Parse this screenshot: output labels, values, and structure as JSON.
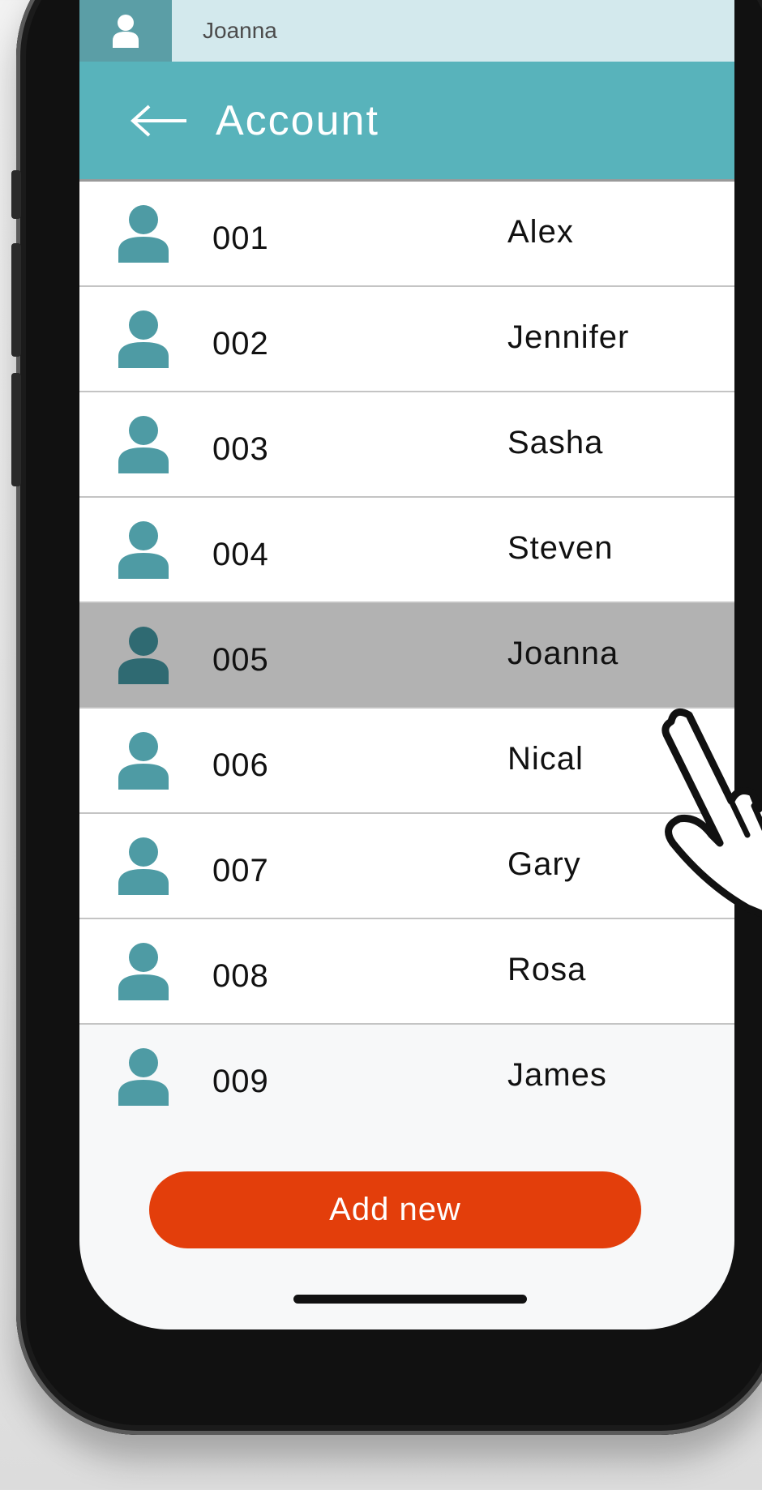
{
  "status_bar": {
    "user_name": "Joanna"
  },
  "header": {
    "title": "Account"
  },
  "accounts": [
    {
      "id": "001",
      "name": "Alex",
      "selected": false
    },
    {
      "id": "002",
      "name": "Jennifer",
      "selected": false
    },
    {
      "id": "003",
      "name": "Sasha",
      "selected": false
    },
    {
      "id": "004",
      "name": "Steven",
      "selected": false
    },
    {
      "id": "005",
      "name": "Joanna",
      "selected": true
    },
    {
      "id": "006",
      "name": "Nical",
      "selected": false
    },
    {
      "id": "007",
      "name": "Gary",
      "selected": false
    },
    {
      "id": "008",
      "name": "Rosa",
      "selected": false
    },
    {
      "id": "009",
      "name": "James",
      "selected": false
    }
  ],
  "actions": {
    "add_new_label": "Add new"
  },
  "icons": {
    "user": "user-icon",
    "back": "back-arrow-icon",
    "pointer": "hand-pointer-icon"
  },
  "colors": {
    "header": "#58b3bb",
    "user_bar": "#d3e9ed",
    "avatar": "#4e9ba4",
    "avatar_selected": "#2f6a72",
    "selected_row": "#b2b2b2",
    "add_button": "#e33e0b"
  }
}
